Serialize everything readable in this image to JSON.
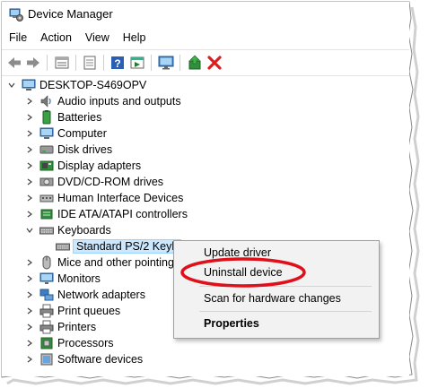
{
  "window": {
    "title": "Device Manager"
  },
  "menu": [
    "File",
    "Action",
    "View",
    "Help"
  ],
  "toolbar": {
    "buttons": [
      "back-icon",
      "forward-icon",
      "properties-icon",
      "driver-icon",
      "help-icon",
      "action-icon",
      "monitor-icon",
      "update-driver-icon",
      "uninstall-icon"
    ]
  },
  "tree": {
    "root": "DESKTOP-S469OPV",
    "categories": [
      {
        "label": "Audio inputs and outputs",
        "icon": "speaker-icon"
      },
      {
        "label": "Batteries",
        "icon": "battery-icon"
      },
      {
        "label": "Computer",
        "icon": "computer-icon"
      },
      {
        "label": "Disk drives",
        "icon": "disk-icon"
      },
      {
        "label": "Display adapters",
        "icon": "display-adapter-icon"
      },
      {
        "label": "DVD/CD-ROM drives",
        "icon": "dvd-icon"
      },
      {
        "label": "Human Interface Devices",
        "icon": "hid-icon"
      },
      {
        "label": "IDE ATA/ATAPI controllers",
        "icon": "ide-icon"
      },
      {
        "label": "Keyboards",
        "icon": "keyboard-icon",
        "expanded": true
      },
      {
        "label": "Standard PS/2 Keyb",
        "icon": "keyboard-icon",
        "child": true,
        "selected": true
      },
      {
        "label": "Mice and other pointing",
        "icon": "mouse-icon"
      },
      {
        "label": "Monitors",
        "icon": "monitor-icon"
      },
      {
        "label": "Network adapters",
        "icon": "network-icon"
      },
      {
        "label": "Print queues",
        "icon": "printer-icon"
      },
      {
        "label": "Printers",
        "icon": "printer-icon"
      },
      {
        "label": "Processors",
        "icon": "processor-icon"
      },
      {
        "label": "Software devices",
        "icon": "software-icon"
      }
    ]
  },
  "context_menu": {
    "update_driver": "Update driver",
    "uninstall_device": "Uninstall device",
    "scan": "Scan for hardware changes",
    "properties": "Properties"
  },
  "colors": {
    "selection": "#cce8ff",
    "highlight_ellipse": "#e0101a",
    "uninstall_x": "#d9201f"
  }
}
